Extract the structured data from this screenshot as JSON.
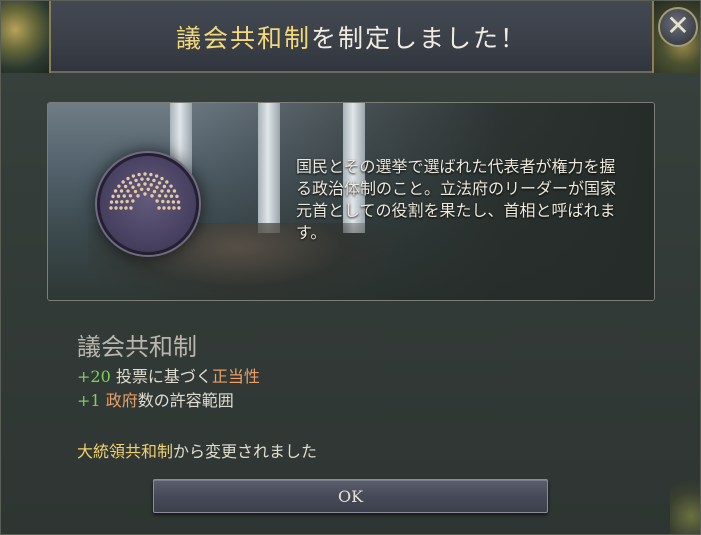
{
  "dialog": {
    "title_highlight": "議会共和制",
    "title_rest": "を制定しました！",
    "close_label": "✕"
  },
  "panel": {
    "description": "国民とその選挙で選ばれた代表者が権力を握る政治体制のこと。立法府のリーダーが国家元首としての役割を果たし、首相と呼ばれます。"
  },
  "government": {
    "name": "議会共和制",
    "effects": [
      {
        "value": "+20",
        "pre": "",
        "keyword1": "投票",
        "mid": "に基づく",
        "keyword2": "正当性"
      },
      {
        "value": "+1",
        "pre": "",
        "keyword1": "政府",
        "mid": "数の許容範囲",
        "keyword2": ""
      }
    ],
    "change": {
      "previous": "大統領共和制",
      "suffix": "から変更されました"
    }
  },
  "buttons": {
    "ok_label": "OK"
  },
  "colors": {
    "title_highlight": "#f4d97a",
    "positive_value": "#7fd05a",
    "keyword": "#e8a068",
    "previous_gov": "#f0d070"
  },
  "icons": {
    "emblem": "parliament-emblem-icon",
    "close": "close-icon"
  }
}
